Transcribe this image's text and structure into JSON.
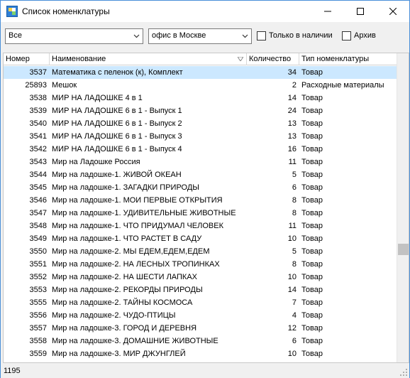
{
  "window": {
    "title": "Список номенклатуры"
  },
  "toolbar": {
    "category": "Все",
    "location": "офис в Москве",
    "in_stock_label": "Только в наличии",
    "archive_label": "Архив"
  },
  "table": {
    "headers": {
      "number": "Номер",
      "name": "Наименование",
      "qty": "Количество",
      "type": "Тип номенклатуры"
    },
    "rows": [
      {
        "number": "3537",
        "name": "Математика с пеленок (к), Комплект",
        "qty": "34",
        "type": "Товар"
      },
      {
        "number": "25893",
        "name": "Мешок",
        "qty": "2",
        "type": "Расходные материалы"
      },
      {
        "number": "3538",
        "name": "МИР НА ЛАДОШКЕ 4 в 1",
        "qty": "14",
        "type": "Товар"
      },
      {
        "number": "3539",
        "name": "МИР НА ЛАДОШКЕ 6 в 1 - Выпуск 1",
        "qty": "24",
        "type": "Товар"
      },
      {
        "number": "3540",
        "name": "МИР НА ЛАДОШКЕ 6 в 1 - Выпуск 2",
        "qty": "13",
        "type": "Товар"
      },
      {
        "number": "3541",
        "name": "МИР НА ЛАДОШКЕ 6 в 1 - Выпуск 3",
        "qty": "13",
        "type": "Товар"
      },
      {
        "number": "3542",
        "name": "МИР НА ЛАДОШКЕ 6 в 1 - Выпуск 4",
        "qty": "16",
        "type": "Товар"
      },
      {
        "number": "3543",
        "name": "Мир на Ладошке Россия",
        "qty": "11",
        "type": "Товар"
      },
      {
        "number": "3544",
        "name": "Мир на ладошке-1. ЖИВОЙ ОКЕАН",
        "qty": "5",
        "type": "Товар"
      },
      {
        "number": "3545",
        "name": "Мир на ладошке-1. ЗАГАДКИ ПРИРОДЫ",
        "qty": "6",
        "type": "Товар"
      },
      {
        "number": "3546",
        "name": "Мир на ладошке-1. МОИ ПЕРВЫЕ ОТКРЫТИЯ",
        "qty": "8",
        "type": "Товар"
      },
      {
        "number": "3547",
        "name": "Мир на ладошке-1. УДИВИТЕЛЬНЫЕ ЖИВОТНЫЕ",
        "qty": "8",
        "type": "Товар"
      },
      {
        "number": "3548",
        "name": "Мир на ладошке-1. ЧТО ПРИДУМАЛ ЧЕЛОВЕК",
        "qty": "11",
        "type": "Товар"
      },
      {
        "number": "3549",
        "name": "Мир на ладошке-1. ЧТО РАСТЕТ В САДУ",
        "qty": "10",
        "type": "Товар"
      },
      {
        "number": "3550",
        "name": "Мир на ладошке-2. МЫ ЕДЕМ,ЕДЕМ,ЕДЕМ",
        "qty": "5",
        "type": "Товар"
      },
      {
        "number": "3551",
        "name": "Мир на ладошке-2. НА ЛЕСНЫХ ТРОПИНКАХ",
        "qty": "8",
        "type": "Товар"
      },
      {
        "number": "3552",
        "name": "Мир на ладошке-2. НА ШЕСТИ ЛАПКАХ",
        "qty": "10",
        "type": "Товар"
      },
      {
        "number": "3553",
        "name": "Мир на ладошке-2. РЕКОРДЫ ПРИРОДЫ",
        "qty": "14",
        "type": "Товар"
      },
      {
        "number": "3555",
        "name": "Мир на ладошке-2. ТАЙНЫ КОСМОСА",
        "qty": "7",
        "type": "Товар"
      },
      {
        "number": "3556",
        "name": "Мир на ладошке-2. ЧУДО-ПТИЦЫ",
        "qty": "4",
        "type": "Товар"
      },
      {
        "number": "3557",
        "name": "Мир на ладошке-3. ГОРОД И ДЕРЕВНЯ",
        "qty": "12",
        "type": "Товар"
      },
      {
        "number": "3558",
        "name": "Мир на ладошке-3. ДОМАШНИЕ ЖИВОТНЫЕ",
        "qty": "6",
        "type": "Товар"
      },
      {
        "number": "3559",
        "name": "Мир на ладошке-3. МИР ДЖУНГЛЕЙ",
        "qty": "10",
        "type": "Товар"
      }
    ]
  },
  "status": {
    "count": "1195"
  }
}
